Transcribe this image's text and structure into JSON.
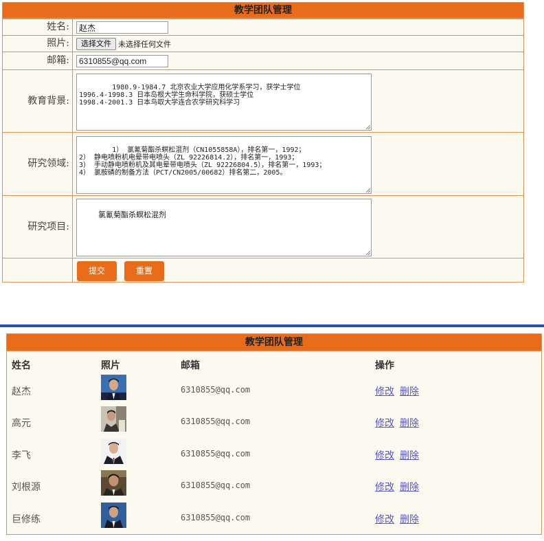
{
  "form": {
    "title": "教学团队管理",
    "name_label": "姓名:",
    "name_value": "赵杰",
    "photo_label": "照片:",
    "file_button": "选择文件",
    "file_status": "未选择任何文件",
    "email_label": "邮箱:",
    "email_value": "6310855@qq.com",
    "education_label": "教育背景:",
    "education_value": "1980.9-1984.7 北京农业大学应用化学系学习，获学士学位\n1996.4-1998.3 日本岛根大学生命科学院，获硕士学位\n1998.4-2001.3 日本鸟取大学连合农学研究科学习",
    "research_label": "研究领域:",
    "research_value": "1） 氯氰菊酯杀螟松混剂（CN1055858A），排名第一，1992；\n2） 静电喷粉机电晕带电喷头（ZL 92226814.2），排名第一，1993；\n3） 手动静电喷粉机及其电晕带电喷头（ZL 92226804.5），排名第一，1993；\n4） 氯胺磷的制备方法（PCT/CN2005/00682）排名第二，2005。",
    "project_label": "研究项目:",
    "project_value": "氯氰菊酯杀螟松混剂",
    "submit_label": "提交",
    "reset_label": "重置",
    "accent_color": "#e86c1a"
  },
  "list": {
    "title": "教学团队管理",
    "headers": {
      "name": "姓名",
      "photo": "照片",
      "email": "邮箱",
      "actions": "操作"
    },
    "rows": [
      {
        "name": "赵杰",
        "email": "6310855@qq.com",
        "edit": "修改",
        "delete": "删除"
      },
      {
        "name": "高元",
        "email": "6310855@qq.com",
        "edit": "修改",
        "delete": "删除"
      },
      {
        "name": "李飞",
        "email": "6310855@qq.com",
        "edit": "修改",
        "delete": "删除"
      },
      {
        "name": "刘根源",
        "email": "6310855@qq.com",
        "edit": "修改",
        "delete": "删除"
      },
      {
        "name": "巨修练",
        "email": "6310855@qq.com",
        "edit": "修改",
        "delete": "删除"
      }
    ],
    "divider_color": "#2552a8"
  }
}
